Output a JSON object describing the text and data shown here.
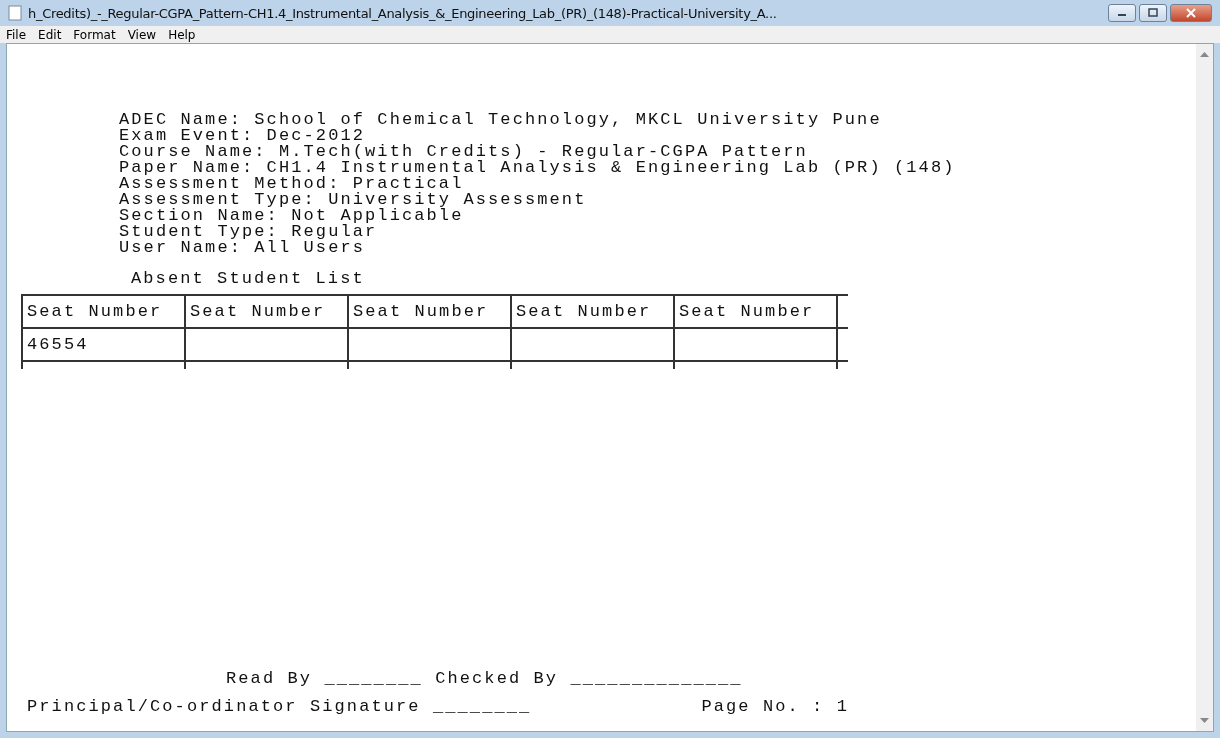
{
  "window": {
    "title": "h_Credits)_-_Regular-CGPA_Pattern-CH1.4_Instrumental_Analysis_&_Engineering_Lab_(PR)_(148)-Practical-University_A..."
  },
  "menu": [
    "File",
    "Edit",
    "Format",
    "View",
    "Help"
  ],
  "header_lines": [
    "ADEC Name: School of Chemical Technology, MKCL University Pune",
    "Exam Event: Dec-2012",
    "Course Name: M.Tech(with Credits) - Regular-CGPA Pattern",
    "Paper Name: CH1.4 Instrumental Analysis & Engineering Lab (PR) (148)",
    "Assessment Method: Practical",
    "Assessment Type: University Assessment",
    "Section Name: Not Applicable",
    "Student Type: Regular",
    "User Name: All Users"
  ],
  "list_title": "Absent Student List",
  "table": {
    "columns": [
      "Seat Number",
      "Seat Number",
      "Seat Number",
      "Seat Number",
      "Seat Number"
    ],
    "rows": [
      [
        "46554",
        "",
        "",
        "",
        ""
      ]
    ]
  },
  "footer": {
    "read_line": "Read By ________ Checked By ______________",
    "signature_line": "Principal/Co-ordinator Signature ________",
    "page": "Page No. : 1"
  }
}
